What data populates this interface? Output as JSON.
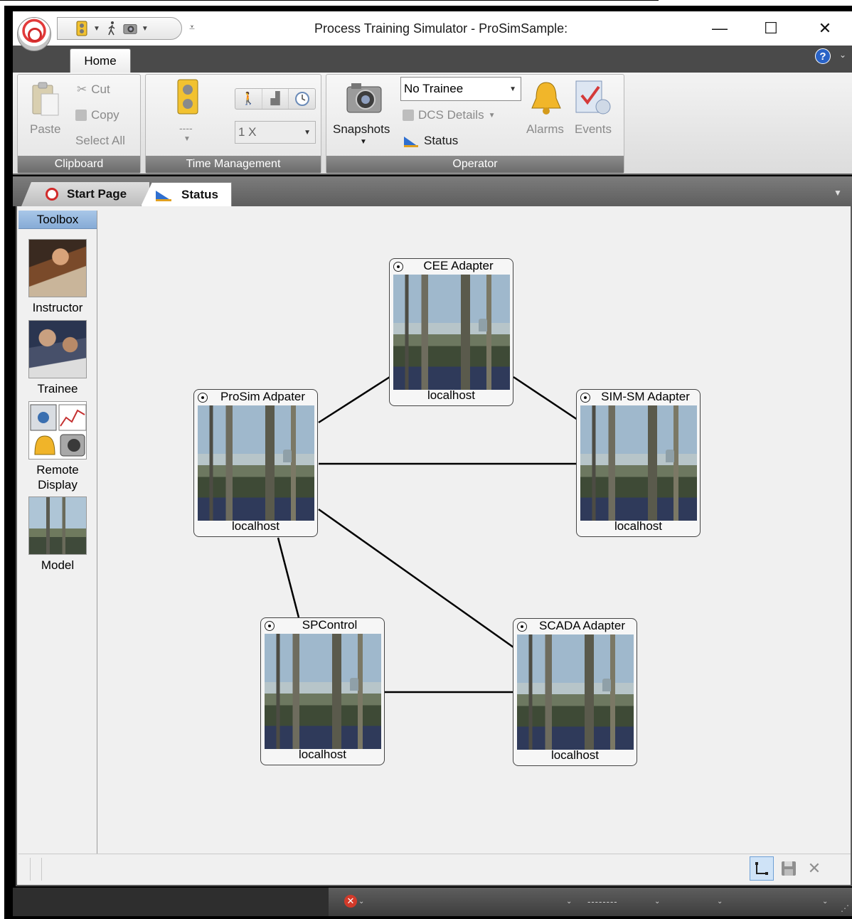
{
  "window": {
    "title": "Process Training Simulator - ProSimSample:",
    "minimize_glyph": "—",
    "maximize_glyph": "☐",
    "close_glyph": "✕"
  },
  "ribbon": {
    "active_tab": "Home",
    "groups": {
      "clipboard": {
        "label": "Clipboard",
        "paste": "Paste",
        "cut": "Cut",
        "copy": "Copy",
        "select_all": "Select All"
      },
      "time_management": {
        "label": "Time Management",
        "run_state": "----",
        "speed": "1 X"
      },
      "operator": {
        "label": "Operator",
        "snapshots": "Snapshots",
        "trainee_select": "No Trainee",
        "dcs_details": "DCS Details",
        "status": "Status",
        "alarms": "Alarms",
        "events": "Events"
      }
    }
  },
  "doc_tabs": [
    {
      "label": "Start Page",
      "active": false
    },
    {
      "label": "Status",
      "active": true
    }
  ],
  "toolbox": {
    "header": "Toolbox",
    "items": [
      {
        "label": "Instructor",
        "icon": "instructor-photo"
      },
      {
        "label": "Trainee",
        "icon": "trainee-photo"
      },
      {
        "label": "Remote\nDisplay",
        "icon": "remote-display-icon"
      },
      {
        "label": "Model",
        "icon": "model-photo"
      }
    ]
  },
  "diagram": {
    "nodes": [
      {
        "id": "cee",
        "title": "CEE Adapter",
        "host": "localhost"
      },
      {
        "id": "prosim",
        "title": "ProSim Adpater",
        "host": "localhost"
      },
      {
        "id": "simsm",
        "title": "SIM-SM Adapter",
        "host": "localhost"
      },
      {
        "id": "spcontrol",
        "title": "SPControl",
        "host": "localhost"
      },
      {
        "id": "scada",
        "title": "SCADA Adapter",
        "host": "localhost"
      }
    ],
    "edges": [
      [
        "prosim",
        "cee"
      ],
      [
        "cee",
        "simsm"
      ],
      [
        "prosim",
        "simsm"
      ],
      [
        "prosim",
        "spcontrol"
      ],
      [
        "prosim",
        "scada"
      ],
      [
        "spcontrol",
        "scada"
      ]
    ]
  },
  "status_bar": {
    "placeholder": "--------"
  },
  "colors": {
    "toolbox_header": "#a9c7e8",
    "ribbon_group_label": "#7b7b7b",
    "error_badge": "#d23a2a",
    "help_button": "#2a63c6"
  }
}
